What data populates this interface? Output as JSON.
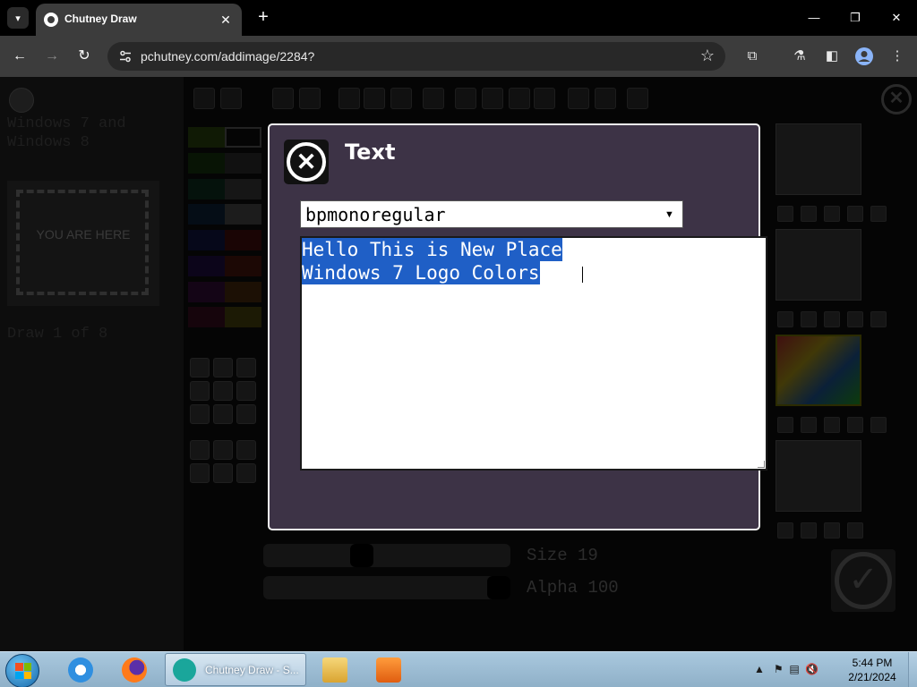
{
  "browser": {
    "tab_title": "Chutney Draw",
    "url": "pchutney.com/addimage/2284?",
    "new_tab_symbol": "+",
    "tab_close_symbol": "✕",
    "window_minimize": "—",
    "window_restore": "❐",
    "window_close": "✕"
  },
  "app": {
    "draw_title": "Windows 7 and Windows 8",
    "placeholder_text": "YOU ARE HERE",
    "draw_count": "Draw 1 of 8",
    "size_label": "Size 19",
    "size_value": 19,
    "alpha_label": "Alpha 100",
    "alpha_value": 100
  },
  "text_dialog": {
    "title": "Text",
    "font": "bpmonoregular",
    "text_lines": [
      "Hello This is New Place",
      "Windows 7 Logo Colors"
    ]
  },
  "taskbar": {
    "active_task": "Chutney Draw - S...",
    "time": "5:44 PM",
    "date": "2/21/2024"
  },
  "colors": {
    "dialog_bg": "#3d3346",
    "selection": "#1f5fc6",
    "chrome_toolbar": "#3c3c3c"
  }
}
